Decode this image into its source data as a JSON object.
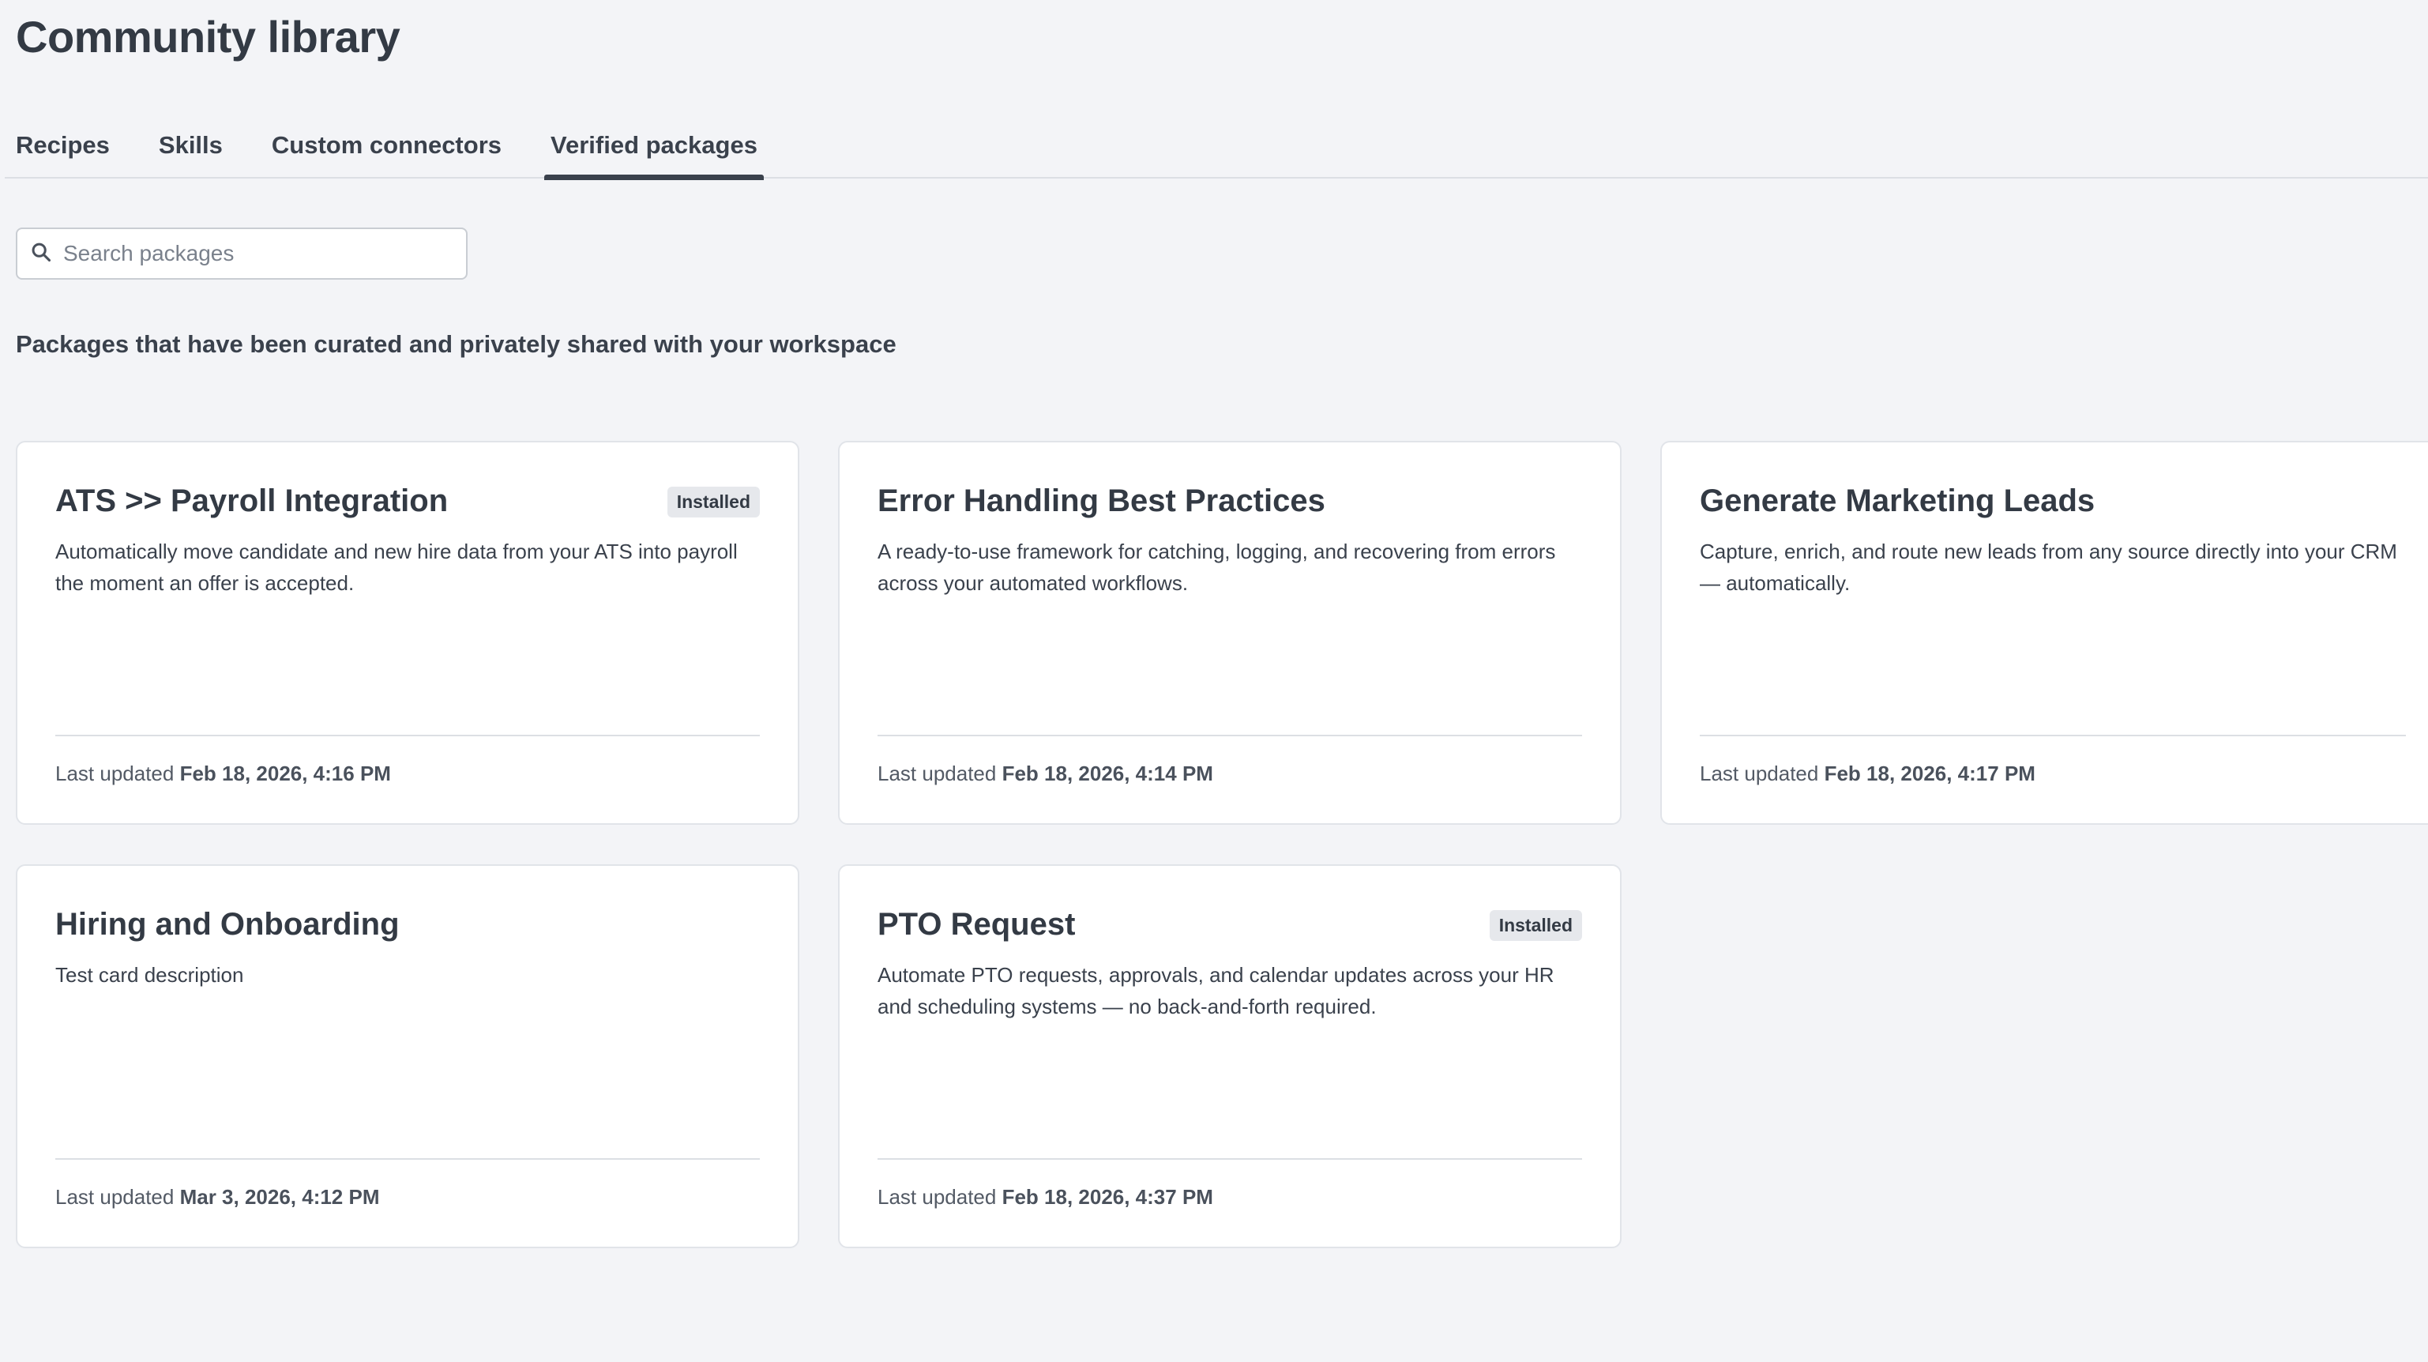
{
  "page": {
    "title": "Community library",
    "subtitle": "Packages that have been curated and privately shared with your workspace"
  },
  "tabs": [
    {
      "label": "Recipes",
      "active": false
    },
    {
      "label": "Skills",
      "active": false
    },
    {
      "label": "Custom connectors",
      "active": false
    },
    {
      "label": "Verified packages",
      "active": true
    }
  ],
  "search": {
    "placeholder": "Search packages",
    "value": "",
    "icon": "search-icon"
  },
  "cards": [
    {
      "title": "ATS >> Payroll Integration",
      "badge": "Installed",
      "description": "Automatically move candidate and new hire data from your ATS into payroll the moment an offer is accepted.",
      "updated_label": "Last updated",
      "updated_value": "Feb 18, 2026, 4:16 PM"
    },
    {
      "title": "Error Handling Best Practices",
      "badge": "",
      "description": "A ready-to-use framework for catching, logging, and recovering from errors across your automated workflows.",
      "updated_label": "Last updated",
      "updated_value": "Feb 18, 2026, 4:14 PM"
    },
    {
      "title": "Generate Marketing Leads",
      "badge": "",
      "description": "Capture, enrich, and route new leads from any source directly into your CRM — automatically.",
      "updated_label": "Last updated",
      "updated_value": "Feb 18, 2026, 4:17 PM"
    },
    {
      "title": "Hiring and Onboarding",
      "badge": "",
      "description": "Test card description",
      "updated_label": "Last updated",
      "updated_value": "Mar 3, 2026, 4:12 PM"
    },
    {
      "title": "PTO Request",
      "badge": "Installed",
      "description": "Automate PTO requests, approvals, and calendar updates across your HR and scheduling systems — no back-and-forth required.",
      "updated_label": "Last updated",
      "updated_value": "Feb 18, 2026, 4:37 PM"
    }
  ]
}
